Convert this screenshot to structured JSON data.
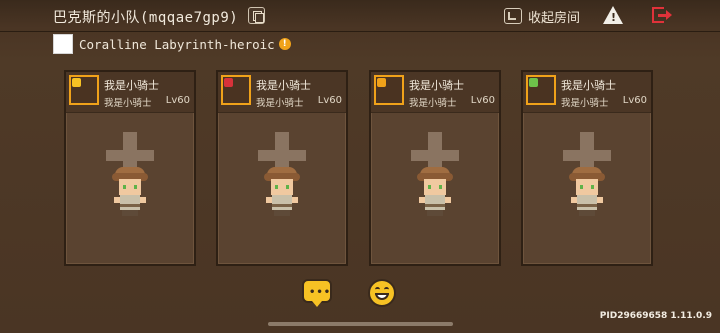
{
  "header": {
    "title": "巴克斯的小队(mqqae7gp9)",
    "collapse_label": "收起房间"
  },
  "mode": {
    "label": "Coralline Labyrinth-heroic",
    "info_symbol": "!"
  },
  "cards": [
    {
      "name": "我是小骑士",
      "sub": "我是小骑士",
      "level": "Lv60",
      "badge_color": "#f7c224"
    },
    {
      "name": "我是小骑士",
      "sub": "我是小骑士",
      "level": "Lv60",
      "badge_color": "#d8323a"
    },
    {
      "name": "我是小骑士",
      "sub": "我是小骑士",
      "level": "Lv60",
      "badge_color": "#f0a21a"
    },
    {
      "name": "我是小骑士",
      "sub": "我是小骑士",
      "level": "Lv60",
      "badge_color": "#6ec24a"
    }
  ],
  "emotes": {
    "chat_dots": "•••"
  },
  "footer": {
    "pid": "PID29669658 1.11.0.9"
  },
  "colors": {
    "accent": "#f0a21a",
    "exit": "#e0323a"
  }
}
